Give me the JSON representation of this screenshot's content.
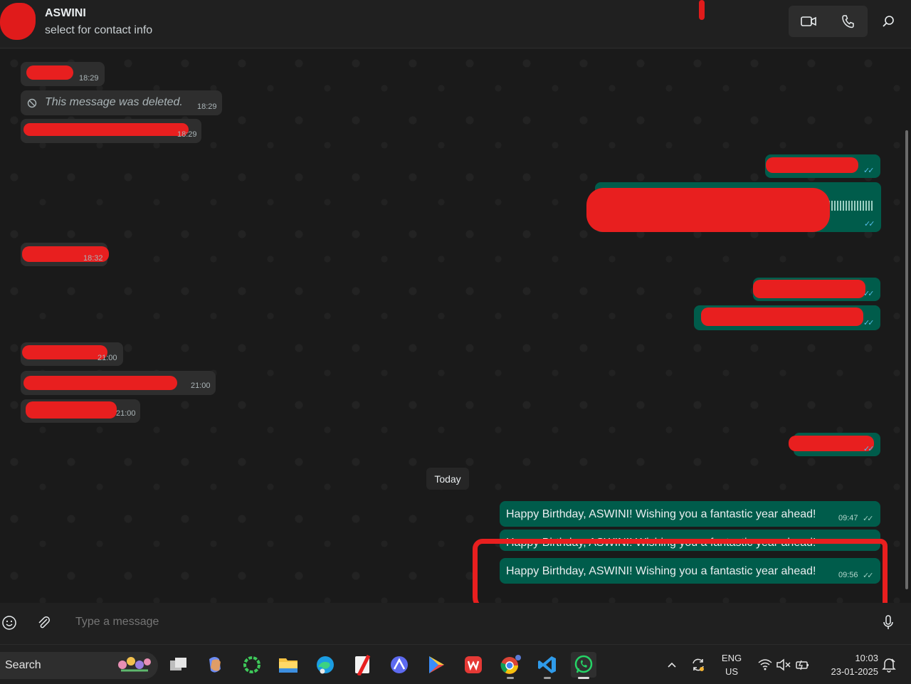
{
  "header": {
    "contact_name": "ASWINI",
    "contact_subtitle": "select for contact info"
  },
  "messages_in": [
    {
      "time": "18:29"
    },
    {
      "text": "This message was deleted.",
      "time": "18:29"
    },
    {
      "time": "18:29"
    },
    {
      "time": "18:32"
    },
    {
      "time": "21:00"
    },
    {
      "time": "21:00"
    },
    {
      "time": "21:00"
    }
  ],
  "separator": {
    "label": "Today"
  },
  "messages_out": [
    {
      "text": "Happy Birthday, ASWINI! Wishing you a fantastic year ahead!",
      "time": "09:47"
    },
    {
      "text": "Happy Birthday, ASWINI! Wishing you a fantastic year ahead!",
      "time": ""
    },
    {
      "text": "Happy Birthday, ASWINI! Wishing you a fantastic year ahead!",
      "time": "09:56"
    }
  ],
  "composer": {
    "placeholder": "Type a message"
  },
  "taskbar": {
    "search_label": "Search",
    "lang_top": "ENG",
    "lang_bottom": "US",
    "clock_time": "10:03",
    "clock_date": "23-01-2025"
  },
  "colors": {
    "outgoing_bubble": "#005c4b",
    "incoming_bubble": "#2e2e2e",
    "read_ticks": "#53bdeb",
    "annotation_red": "#e81f1f"
  }
}
